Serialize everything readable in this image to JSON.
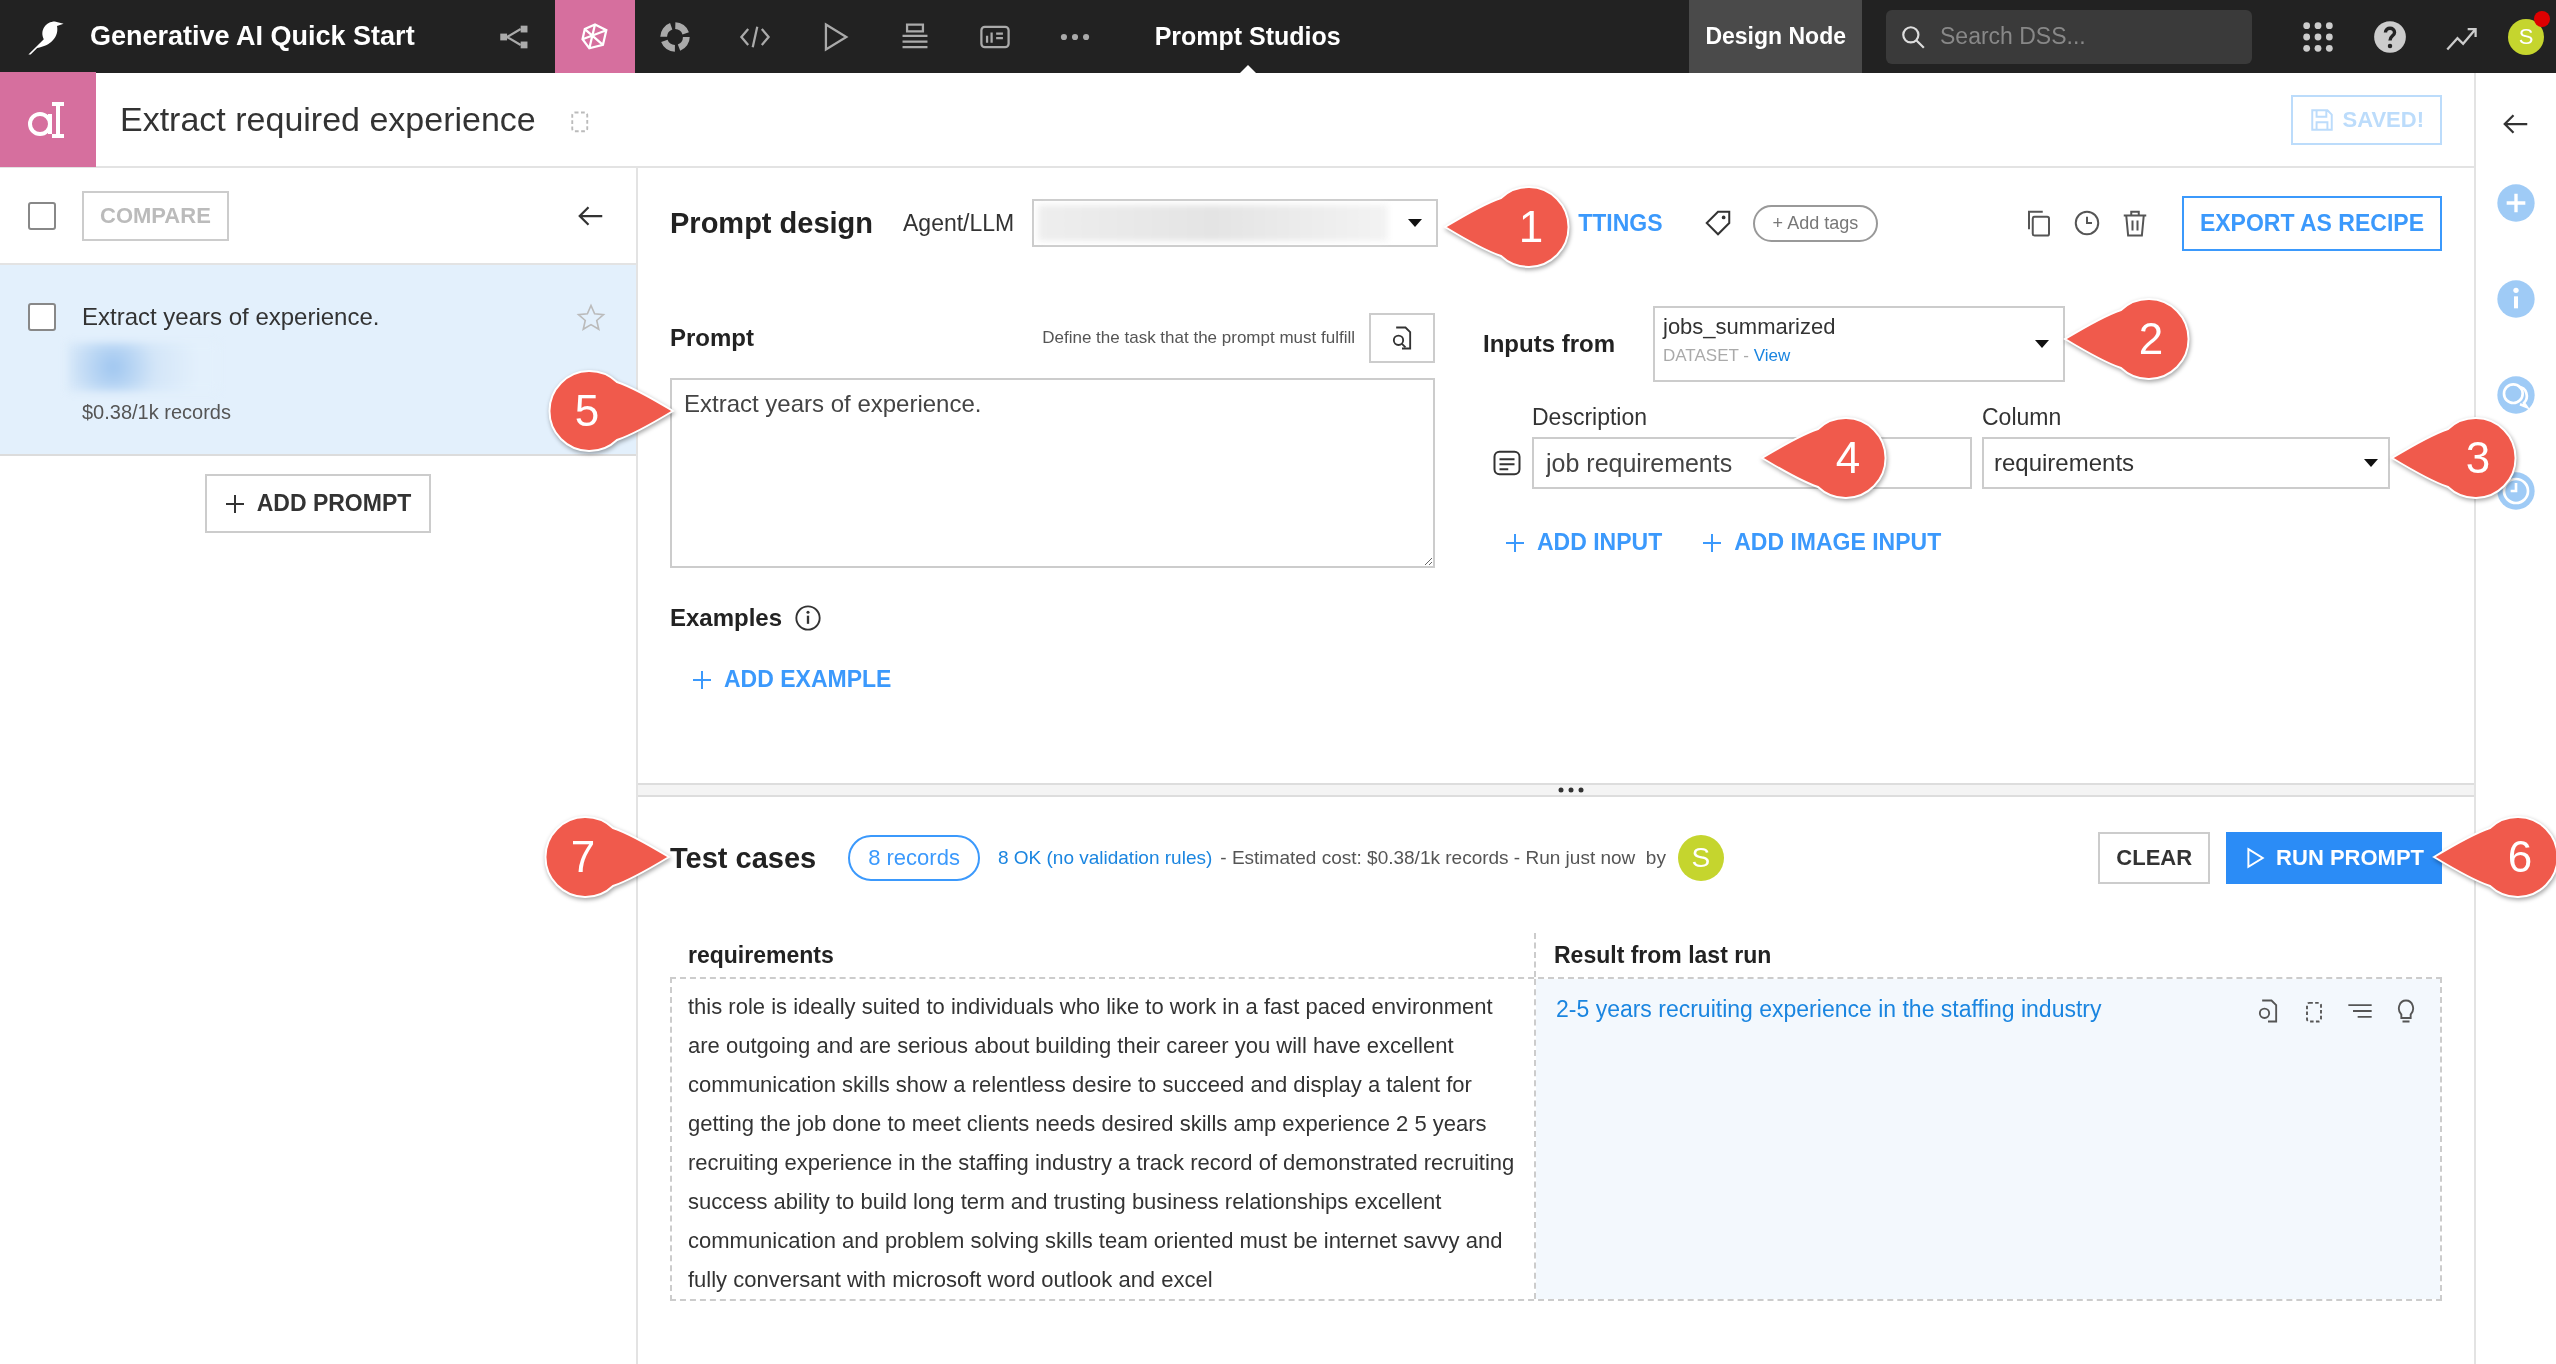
{
  "topbar": {
    "project_title": "Generative AI Quick Start",
    "nav_icons": [
      {
        "kind": "flow",
        "selected": false
      },
      {
        "kind": "lab",
        "selected": true
      },
      {
        "kind": "ring",
        "selected": false
      },
      {
        "kind": "code",
        "selected": false
      },
      {
        "kind": "run",
        "selected": false
      },
      {
        "kind": "stack",
        "selected": false
      },
      {
        "kind": "dashboard",
        "selected": false
      },
      {
        "kind": "more",
        "selected": false
      }
    ],
    "section": "Prompt Studios",
    "node_label": "Design Node",
    "search": {
      "placeholder": "Search DSS..."
    },
    "avatar": {
      "initial": "S",
      "notification": true
    }
  },
  "header": {
    "title": "Extract required experience",
    "save_button": {
      "label": "SAVED!",
      "disabled": true
    }
  },
  "prompt_list": {
    "select_all_checked": false,
    "compare_label": "COMPARE",
    "items": [
      {
        "title": "Extract years of experience.",
        "cost": "$0.38/1k records",
        "selected": true,
        "checked": false,
        "starred": false
      }
    ],
    "add_button": "ADD PROMPT"
  },
  "prompt_design": {
    "title": "Prompt design",
    "agent_label": "Agent/LLM",
    "settings_link": "TTINGS",
    "add_tags": "+ Add tags",
    "export_button": "EXPORT AS RECIPE",
    "prompt": {
      "label": "Prompt",
      "hint": "Define the task that the prompt must fulfill",
      "value": "Extract years of experience."
    },
    "examples": {
      "label": "Examples",
      "add_button": "ADD EXAMPLE"
    },
    "inputs": {
      "label": "Inputs from",
      "dataset": "jobs_summarized",
      "dataset_type": "DATASET -",
      "view_link": "View",
      "description_label": "Description",
      "column_label": "Column",
      "description_value": "job requirements",
      "column_value": "requirements",
      "add_input": "ADD INPUT",
      "add_image_input": "ADD IMAGE INPUT"
    }
  },
  "test_cases": {
    "title": "Test cases",
    "records": "8 records",
    "status_link": "8 OK (no validation rules)",
    "summary": "- Estimated cost: $0.38/1k records - Run just now  by",
    "run_by_initial": "S",
    "clear_button": "CLEAR",
    "run_button": "RUN PROMPT",
    "columns": [
      "requirements",
      "Result from last run"
    ],
    "rows": [
      {
        "input": "this role is ideally suited to individuals who like to work in a fast paced environment are outgoing and are serious about building their career you will have excellent communication skills show a relentless desire to succeed and display a talent for getting the job done to meet clients needs desired skills amp experience 2 5 years recruiting experience in the staffing industry a track record of demonstrated recruiting success ability to build long term and trusting business relationships excellent communication and problem solving skills team oriented must be internet savvy and fully conversant with microsoft word outlook and excel",
        "result": "2-5 years recruiting experience in the staffing industry"
      }
    ]
  },
  "callouts": [
    {
      "number": "1"
    },
    {
      "number": "2"
    },
    {
      "number": "3"
    },
    {
      "number": "4"
    },
    {
      "number": "5"
    },
    {
      "number": "6"
    },
    {
      "number": "7"
    }
  ]
}
